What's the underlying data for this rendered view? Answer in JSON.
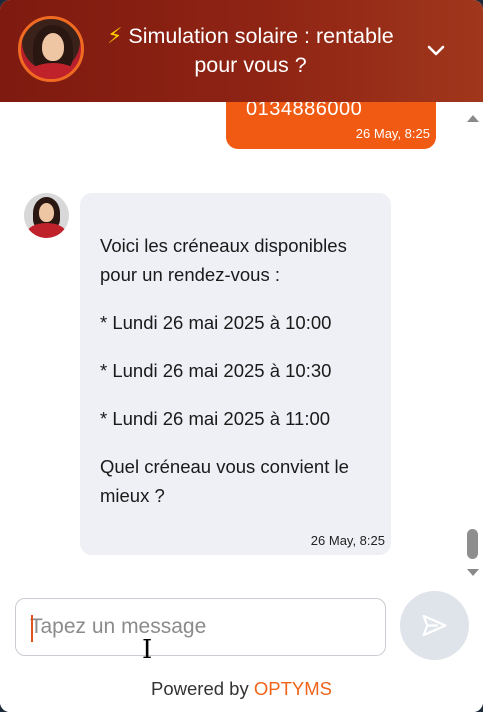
{
  "header": {
    "title_emoji": "⚡",
    "title": "Simulation solaire : rentable pour vous ?",
    "collapse_icon": "chevron-down-icon"
  },
  "messages": [
    {
      "from": "user",
      "text": "0134886000",
      "timestamp": "26 May, 8:25"
    },
    {
      "from": "bot",
      "lines": [
        "Voici les créneaux disponibles pour un rendez-vous :",
        "* Lundi 26 mai 2025 à 10:00",
        "* Lundi 26 mai 2025 à 10:30",
        "* Lundi 26 mai 2025 à 11:00",
        "Quel créneau vous convient le mieux ?"
      ],
      "timestamp": "26 May, 8:25"
    }
  ],
  "composer": {
    "placeholder": "Tapez un message",
    "send_icon": "send-icon"
  },
  "footer": {
    "powered_by": "Powered by",
    "brand": "OPTYMS"
  },
  "colors": {
    "header_start": "#7e1a10",
    "header_end": "#a0371c",
    "accent": "#f05a12",
    "bot_bubble": "#eef0f5",
    "brand": "#f0641a"
  }
}
